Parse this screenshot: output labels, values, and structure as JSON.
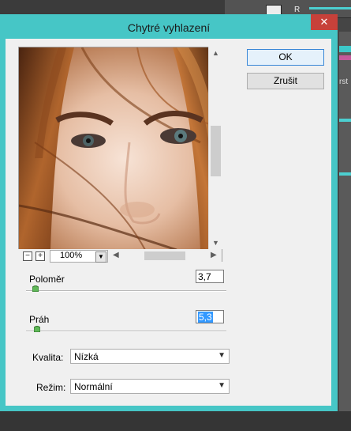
{
  "dialog": {
    "title": "Chytré vyhlazení",
    "close_glyph": "✕",
    "ok_label": "OK",
    "cancel_label": "Zrušit"
  },
  "preview": {
    "zoom_value": "100%",
    "zoom_out_glyph": "−",
    "zoom_in_glyph": "+"
  },
  "radius": {
    "label": "Poloměr",
    "value": "3,7",
    "slider_fraction": 0.03
  },
  "threshold": {
    "label": "Práh",
    "value": "5,3",
    "slider_fraction": 0.04
  },
  "quality": {
    "label": "Kvalita:",
    "value": "Nízká"
  },
  "mode": {
    "label": "Režim:",
    "value": "Normální"
  },
  "background": {
    "channel_label": "R",
    "panel_text": "rst"
  },
  "colors": {
    "window_frame": "#46c6c6",
    "close_button": "#c7413a",
    "selection": "#3399ff",
    "dialog_bg": "#f0f0f0"
  }
}
